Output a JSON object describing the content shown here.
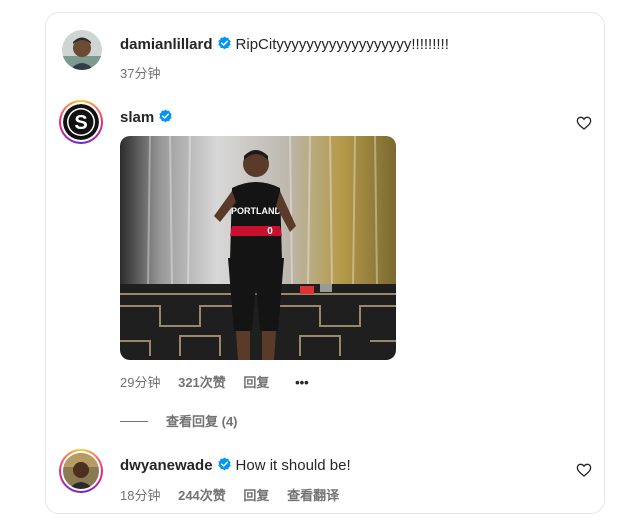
{
  "comments": [
    {
      "username": "damianlillard",
      "text": "RipCityyyyyyyyyyyyyyyyyy!!!!!!!!!",
      "time": "37分钟"
    },
    {
      "username": "slam",
      "time": "29分钟",
      "likes": "321次赞",
      "reply_label": "回复",
      "more_label": "•••",
      "view_replies": "查看回复 (4)"
    },
    {
      "username": "dwyanewade",
      "text": "How it should be!",
      "time": "18分钟",
      "likes": "244次赞",
      "reply_label": "回复",
      "translate_label": "查看翻译"
    }
  ],
  "colors": {
    "verified": "#0095f6",
    "meta_text": "#737373",
    "ring_gradient_start": "#f9ce34",
    "ring_gradient_mid": "#ee2a7b",
    "ring_gradient_end": "#6228d7"
  },
  "icons": {
    "verified": "verified-badge-icon",
    "heart": "heart-outline-icon",
    "more": "more-dots-icon"
  }
}
